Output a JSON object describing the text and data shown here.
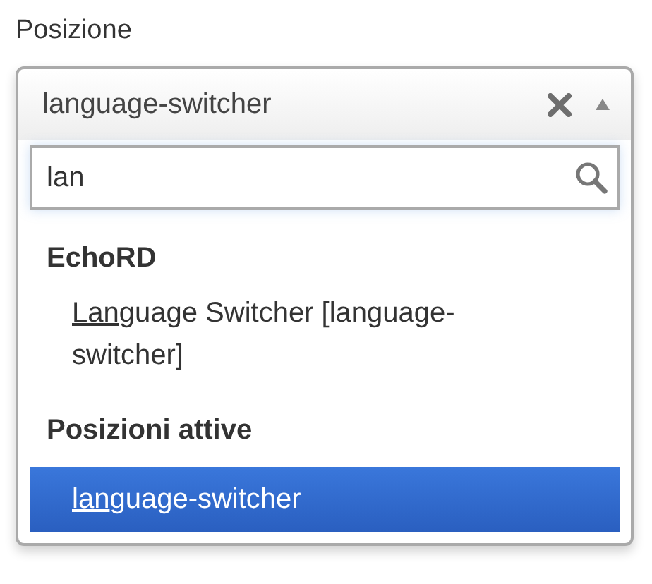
{
  "field_label": "Posizione",
  "select": {
    "value": "language-switcher",
    "expanded": true,
    "search": {
      "value": "lan"
    },
    "groups": [
      {
        "label": "EchoRD",
        "options": [
          {
            "match": "Lan",
            "rest": "guage Switcher [language-switcher]",
            "selected": false
          }
        ]
      },
      {
        "label": "Posizioni attive",
        "options": [
          {
            "match": "lan",
            "rest": "guage-switcher",
            "selected": true
          }
        ]
      }
    ]
  }
}
